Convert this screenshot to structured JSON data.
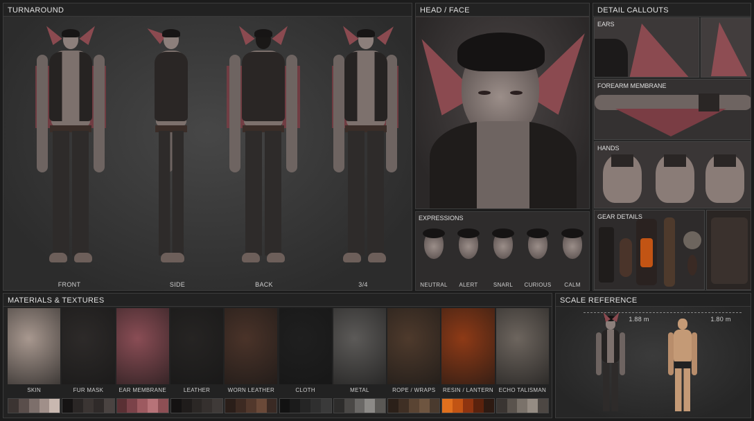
{
  "turnaround": {
    "title": "TURNAROUND",
    "views": [
      "FRONT",
      "SIDE",
      "BACK",
      "3/4"
    ]
  },
  "head_face": {
    "title": "HEAD / FACE"
  },
  "expressions": {
    "title": "EXPRESSIONS",
    "items": [
      "NEUTRAL",
      "ALERT",
      "SNARL",
      "CURIOUS",
      "CALM"
    ]
  },
  "detail_callouts": {
    "title": "DETAIL CALLOUTS",
    "ears": "EARS",
    "forearm": "FOREARM MEMBRANE",
    "hands": "HANDS",
    "gear": "GEAR DETAILS"
  },
  "materials": {
    "title": "MATERIALS & TEXTURES",
    "items": [
      {
        "label": "SKIN",
        "tex": "#a8988f",
        "swatches": [
          "#3b3432",
          "#5a4e4b",
          "#7d6f6b",
          "#a08f89",
          "#c9b8b0"
        ]
      },
      {
        "label": "FUR MASK",
        "tex": "#2d2a29",
        "swatches": [
          "#151313",
          "#2a2625",
          "#3b3533",
          "#2f2a29",
          "#4a4341"
        ]
      },
      {
        "label": "EAR MEMBRANE",
        "tex": "#8a4d55",
        "swatches": [
          "#5a3034",
          "#7b4249",
          "#9d5a60",
          "#b77378",
          "#8d4f54"
        ]
      },
      {
        "label": "LEATHER",
        "tex": "#262423",
        "swatches": [
          "#141212",
          "#1f1c1b",
          "#2b2725",
          "#35302e",
          "#3f3a38"
        ]
      },
      {
        "label": "WORN LEATHER",
        "tex": "#4a3329",
        "swatches": [
          "#2a1e19",
          "#3d2a22",
          "#52382c",
          "#6a4938",
          "#3a2a24"
        ]
      },
      {
        "label": "CLOTH",
        "tex": "#1f1f1f",
        "swatches": [
          "#121212",
          "#1b1b1b",
          "#252525",
          "#2f2f2f",
          "#3a3a3a"
        ]
      },
      {
        "label": "METAL",
        "tex": "#5c5a58",
        "swatches": [
          "#2d2c2b",
          "#4a4846",
          "#6a6866",
          "#8c8a87",
          "#5a5855"
        ]
      },
      {
        "label": "ROPE / WRAPS",
        "tex": "#4e3a2c",
        "swatches": [
          "#2b2019",
          "#3f2f24",
          "#5a4433",
          "#6e5540",
          "#4a3a2e"
        ]
      },
      {
        "label": "RESIN / LANTERN",
        "tex": "#8e3a16",
        "swatches": [
          "#e0701e",
          "#c25414",
          "#8e3410",
          "#5a220d",
          "#2d1a12"
        ]
      },
      {
        "label": "ECHO TALISMAN",
        "tex": "#6d655e",
        "swatches": [
          "#3a3532",
          "#5a534d",
          "#7a726a",
          "#958c83",
          "#4d4743"
        ]
      }
    ]
  },
  "scale": {
    "title": "SCALE REFERENCE",
    "char_height": "1.88 m",
    "human_height": "1.80 m"
  },
  "colors": {
    "panel_bg": "#2a2a2a",
    "membrane": "#8b4a50",
    "skin": "#8c7f7b"
  }
}
